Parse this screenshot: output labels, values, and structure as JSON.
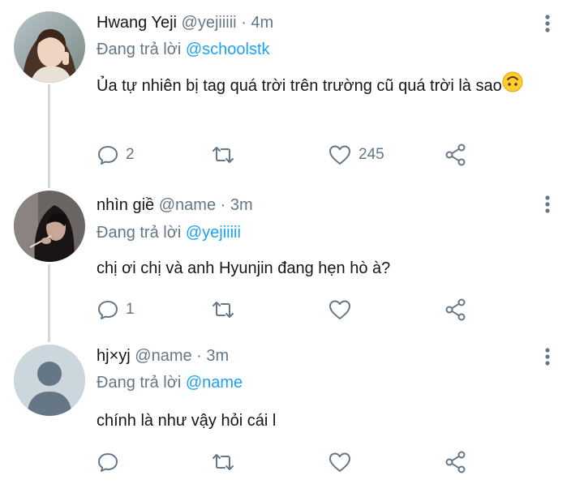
{
  "tweets": [
    {
      "name": "Hwang Yeji",
      "handle": "@yejiiiii",
      "time": "4m",
      "reply_prefix": "Đang trả lời",
      "reply_to": "@schoolstk",
      "text": "Ủa tự nhiên bị tag quá trời trên trường cũ quá trời là sao",
      "emoji": "upside-down-face",
      "replies": "2",
      "likes": "245"
    },
    {
      "name": "nhìn giề",
      "handle": "@name",
      "time": "3m",
      "reply_prefix": "Đang trả lời",
      "reply_to": "@yejiiiii",
      "text": "chị ơi chị và anh Hyunjin đang hẹn hò à?",
      "replies": "1",
      "likes": ""
    },
    {
      "name": "hj×yj",
      "handle": "@name",
      "time": "3m",
      "reply_prefix": "Đang trả lời",
      "reply_to": "@name",
      "text": "chính là như vậy hỏi cái l",
      "replies": "",
      "likes": ""
    }
  ],
  "icons": {
    "reply": "speech-bubble-icon",
    "retweet": "retweet-icon",
    "like": "heart-icon",
    "share": "share-icon",
    "more": "vertical-dots-icon"
  },
  "colors": {
    "link": "#1da1f2",
    "secondary": "#657786",
    "thread_line": "#cfd9de"
  }
}
